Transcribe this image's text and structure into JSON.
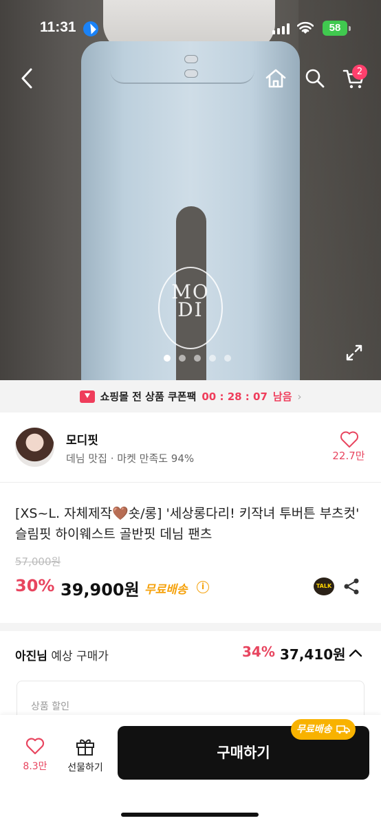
{
  "status_bar": {
    "time": "11:31",
    "battery": "58"
  },
  "header": {
    "cart_count": "2"
  },
  "hero": {
    "logo_text": "MO\nDI",
    "slides": 5,
    "active_slide": 1
  },
  "coupon": {
    "text": "쇼핑몰 전 상품 쿠폰팩",
    "timer": "00 : 28 : 07",
    "remain": "남음",
    "arrow": "›"
  },
  "shop": {
    "name": "모디핏",
    "desc": "데님 맛집 · 마켓 만족도 94%",
    "fav_count": "22.7만"
  },
  "product": {
    "title": "[XS~L. 자체제작🤎숏/롱] '세상롱다리! 키작녀 투버튼 부츠컷' 슬림핏 하이웨스트 골반핏 데님 팬츠",
    "original_price": "57,000원",
    "discount_rate": "30%",
    "price": "39,900원",
    "free_shipping": "무료배송",
    "talk_label": "TALK"
  },
  "expected": {
    "name": "아진님",
    "label": "예상 구매가",
    "rate": "34%",
    "price": "37,410원"
  },
  "discount_box": {
    "label": "상품 할인"
  },
  "bottom": {
    "like_count": "8.3만",
    "gift_label": "선물하기",
    "buy_label": "구매하기",
    "ship_badge": "무료배송"
  },
  "colors": {
    "accent": "#e8455f",
    "shipping": "#f5a20d",
    "buy": "#111111"
  }
}
